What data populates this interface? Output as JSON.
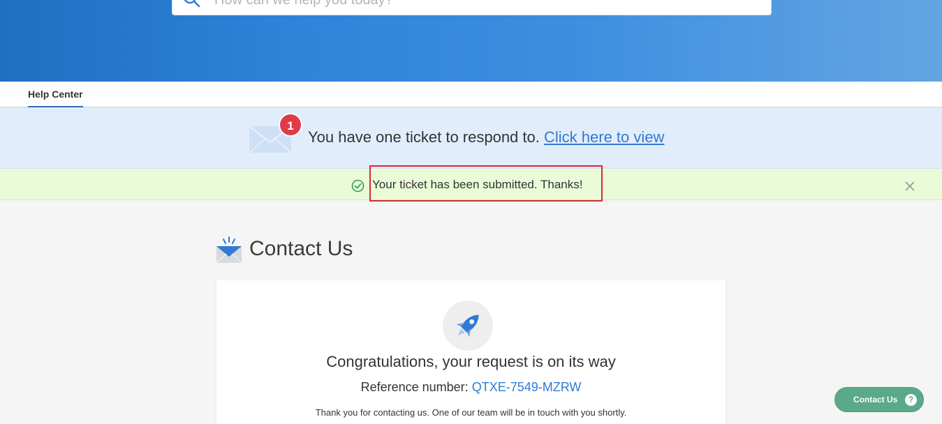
{
  "search": {
    "placeholder": "How can we help you today?"
  },
  "nav": {
    "tab": "Help Center"
  },
  "ticket_banner": {
    "badge_count": "1",
    "message": "You have one ticket to respond to.",
    "link": "Click here to view"
  },
  "success_alert": {
    "message": "Your ticket has been submitted. Thanks!"
  },
  "contact": {
    "title": "Contact Us",
    "congrats": "Congratulations, your request is on its way",
    "reference_label": "Reference number:",
    "reference_number": "QTXE-7549-MZRW",
    "thanks_message": "Thank you for contacting us. One of our team will be in touch with you shortly."
  },
  "floating_button": {
    "label": "Contact Us",
    "help_glyph": "?"
  },
  "colors": {
    "accent": "#2f7bd3",
    "badge": "#e03b4a",
    "success_bg": "#eafbd8",
    "contact_button": "#5aa98a",
    "highlight": "#d42d2d"
  }
}
